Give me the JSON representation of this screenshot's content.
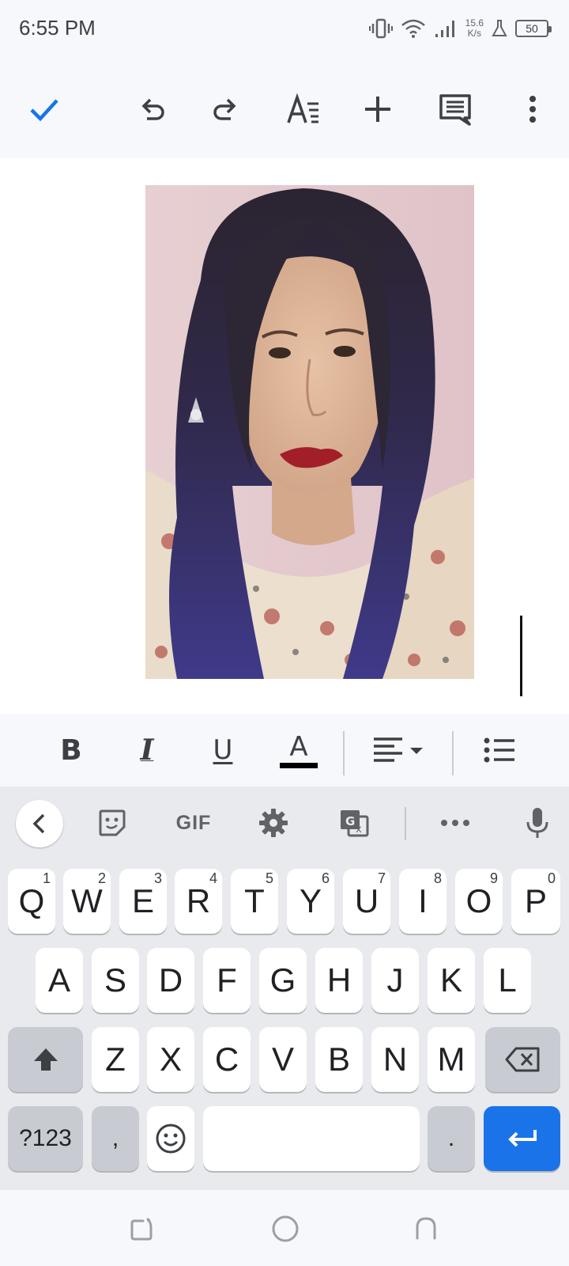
{
  "status_bar": {
    "time": "6:55 PM",
    "net_speed_value": "15.6",
    "net_speed_unit": "K/s",
    "battery_level": "50"
  },
  "doc_toolbar": {
    "icons": [
      "check-icon",
      "undo-icon",
      "redo-icon",
      "text-format-icon",
      "insert-icon",
      "comment-icon",
      "more-options-icon"
    ]
  },
  "document": {
    "image": "portrait photo of a woman with long dark hair with blue streaks, red lipstick, earrings and a patterned top"
  },
  "format_bar": {
    "bold_label": "B",
    "italic_label": "I",
    "underline_label": "U",
    "text_color_label": "A",
    "text_color": "#000000"
  },
  "keyboard": {
    "toolbar": {
      "gif_label": "GIF",
      "icons": [
        "back-icon",
        "sticker-icon",
        "settings-icon",
        "translate-icon",
        "more-icon",
        "mic-icon"
      ]
    },
    "row1": [
      {
        "label": "Q",
        "hint": "1"
      },
      {
        "label": "W",
        "hint": "2"
      },
      {
        "label": "E",
        "hint": "3"
      },
      {
        "label": "R",
        "hint": "4"
      },
      {
        "label": "T",
        "hint": "5"
      },
      {
        "label": "Y",
        "hint": "6"
      },
      {
        "label": "U",
        "hint": "7"
      },
      {
        "label": "I",
        "hint": "8"
      },
      {
        "label": "O",
        "hint": "9"
      },
      {
        "label": "P",
        "hint": "0"
      }
    ],
    "row2": [
      "A",
      "S",
      "D",
      "F",
      "G",
      "H",
      "J",
      "K",
      "L"
    ],
    "row3": [
      "Z",
      "X",
      "C",
      "V",
      "B",
      "N",
      "M"
    ],
    "symbols_label": "?123",
    "comma_label": ",",
    "period_label": ".",
    "enter_color": "#1a73e8"
  },
  "nav_bar": {
    "icons": [
      "recent-apps-icon",
      "home-icon",
      "back-icon"
    ]
  },
  "colors": {
    "accent": "#1a73e8",
    "toolbar_bg": "#f6f8fc",
    "keyboard_bg": "#e8eaed"
  }
}
